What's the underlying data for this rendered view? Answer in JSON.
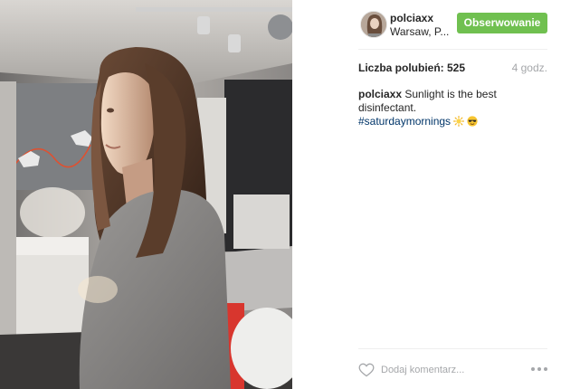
{
  "post": {
    "username": "polciaxx",
    "location": "Warsaw, P...",
    "follow_label": "Obserwowanie",
    "likes": "Liczba polubień: 525",
    "time_ago": "4 godz.",
    "caption_user": "polciaxx",
    "caption_text": "Sunlight is the best disinfectant.",
    "hashtag": "#saturdaymornings",
    "emojis": [
      "sun-icon",
      "sunglasses-face-icon"
    ],
    "comment_placeholder": "Dodaj komentarz..."
  },
  "colors": {
    "follow_button": "#70c050",
    "hashtag": "#003569",
    "muted": "#a5a7aa"
  }
}
